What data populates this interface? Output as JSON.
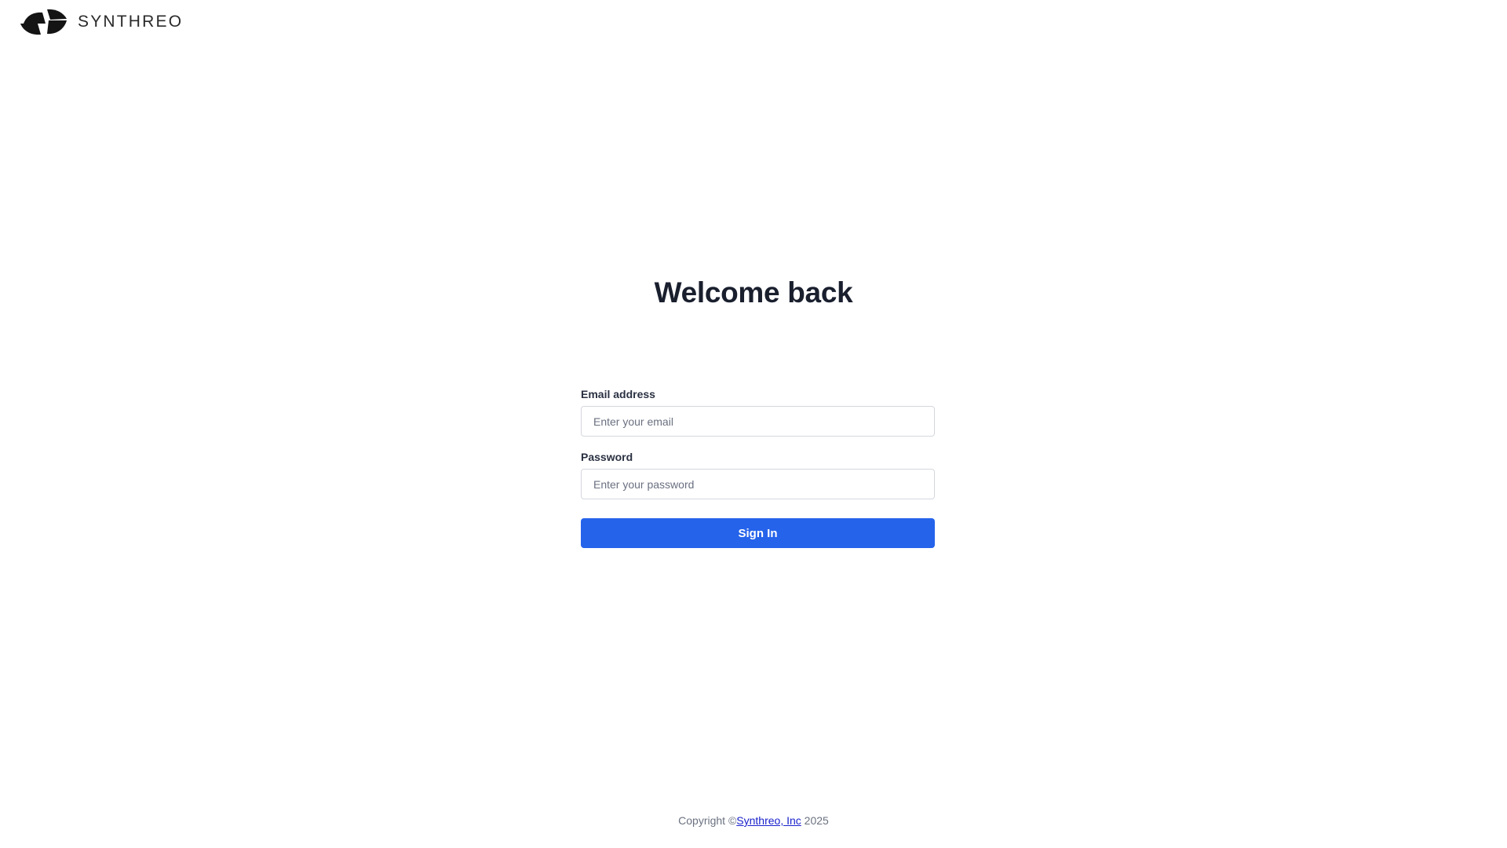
{
  "brand": {
    "name": "SYNTHREO",
    "logo_icon": "synthreo-logo-icon"
  },
  "login": {
    "title": "Welcome back",
    "email": {
      "label": "Email address",
      "placeholder": "Enter your email",
      "value": ""
    },
    "password": {
      "label": "Password",
      "placeholder": "Enter your password",
      "value": ""
    },
    "submit_label": "Sign In"
  },
  "footer": {
    "prefix": "Copyright ©",
    "link_text": "Synthreo, Inc",
    "suffix": " 2025"
  },
  "colors": {
    "accent": "#2563eb",
    "link": "#1a22cc",
    "heading": "#1a1f2e"
  }
}
